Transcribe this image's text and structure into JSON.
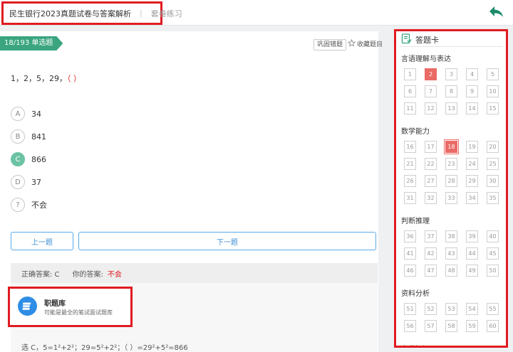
{
  "header": {
    "title": "民生银行2023真题试卷与答案解析",
    "separator": "|",
    "mode": "套卷练习"
  },
  "question": {
    "tag": "18/193 单选题",
    "tools": {
      "consolidate": "巩固错题",
      "favorite": "收藏题目"
    },
    "stem": "1，2，5，29，",
    "stem_paren": "（ ）",
    "options": [
      {
        "letter": "A",
        "text": "34",
        "state": "normal"
      },
      {
        "letter": "B",
        "text": "841",
        "state": "normal"
      },
      {
        "letter": "C",
        "text": "866",
        "state": "correct"
      },
      {
        "letter": "D",
        "text": "37",
        "state": "normal"
      },
      {
        "letter": "?",
        "text": "不会",
        "state": "normal"
      }
    ],
    "prev_label": "上一题",
    "next_label": "下一题"
  },
  "analysis": {
    "correct_label": "正确答案: C",
    "mine_label": "你的答案:",
    "mine_value": "不会",
    "promo_name": "职题库",
    "promo_sub": "可能是最全的笔试面试题库",
    "solution": "选 C，5=1²+2²；29=5²+2²；（ ）=29²+5²=866"
  },
  "answer_sheet": {
    "title": "答题卡",
    "sections": [
      {
        "name": "言语理解与表达",
        "numbers": [
          1,
          2,
          3,
          4,
          5,
          6,
          7,
          8,
          9,
          10,
          11,
          12,
          13,
          14,
          15
        ],
        "answered": [
          2
        ],
        "current": null
      },
      {
        "name": "数学能力",
        "numbers": [
          16,
          17,
          18,
          19,
          20,
          21,
          22,
          23,
          24,
          25,
          26,
          27,
          28,
          29,
          30,
          31,
          32,
          33,
          34,
          35
        ],
        "answered": [
          18
        ],
        "current": 18
      },
      {
        "name": "判断推理",
        "numbers": [
          36,
          37,
          38,
          39,
          40,
          41,
          42,
          43,
          44,
          45,
          46,
          47,
          48,
          49,
          50
        ],
        "answered": [],
        "current": null
      },
      {
        "name": "资料分析",
        "numbers": [
          51,
          52,
          53,
          54,
          55,
          56,
          57,
          58,
          59,
          60
        ],
        "answered": [],
        "current": null
      },
      {
        "name": "专业知识",
        "numbers": [],
        "answered": [],
        "current": null
      }
    ]
  },
  "colors": {
    "accent_green": "#3aa57f",
    "correct_green": "#6cc3a4",
    "highlight_red": "#e01b22",
    "answered_red": "#ea6a66",
    "link_blue": "#3c8fd6"
  }
}
